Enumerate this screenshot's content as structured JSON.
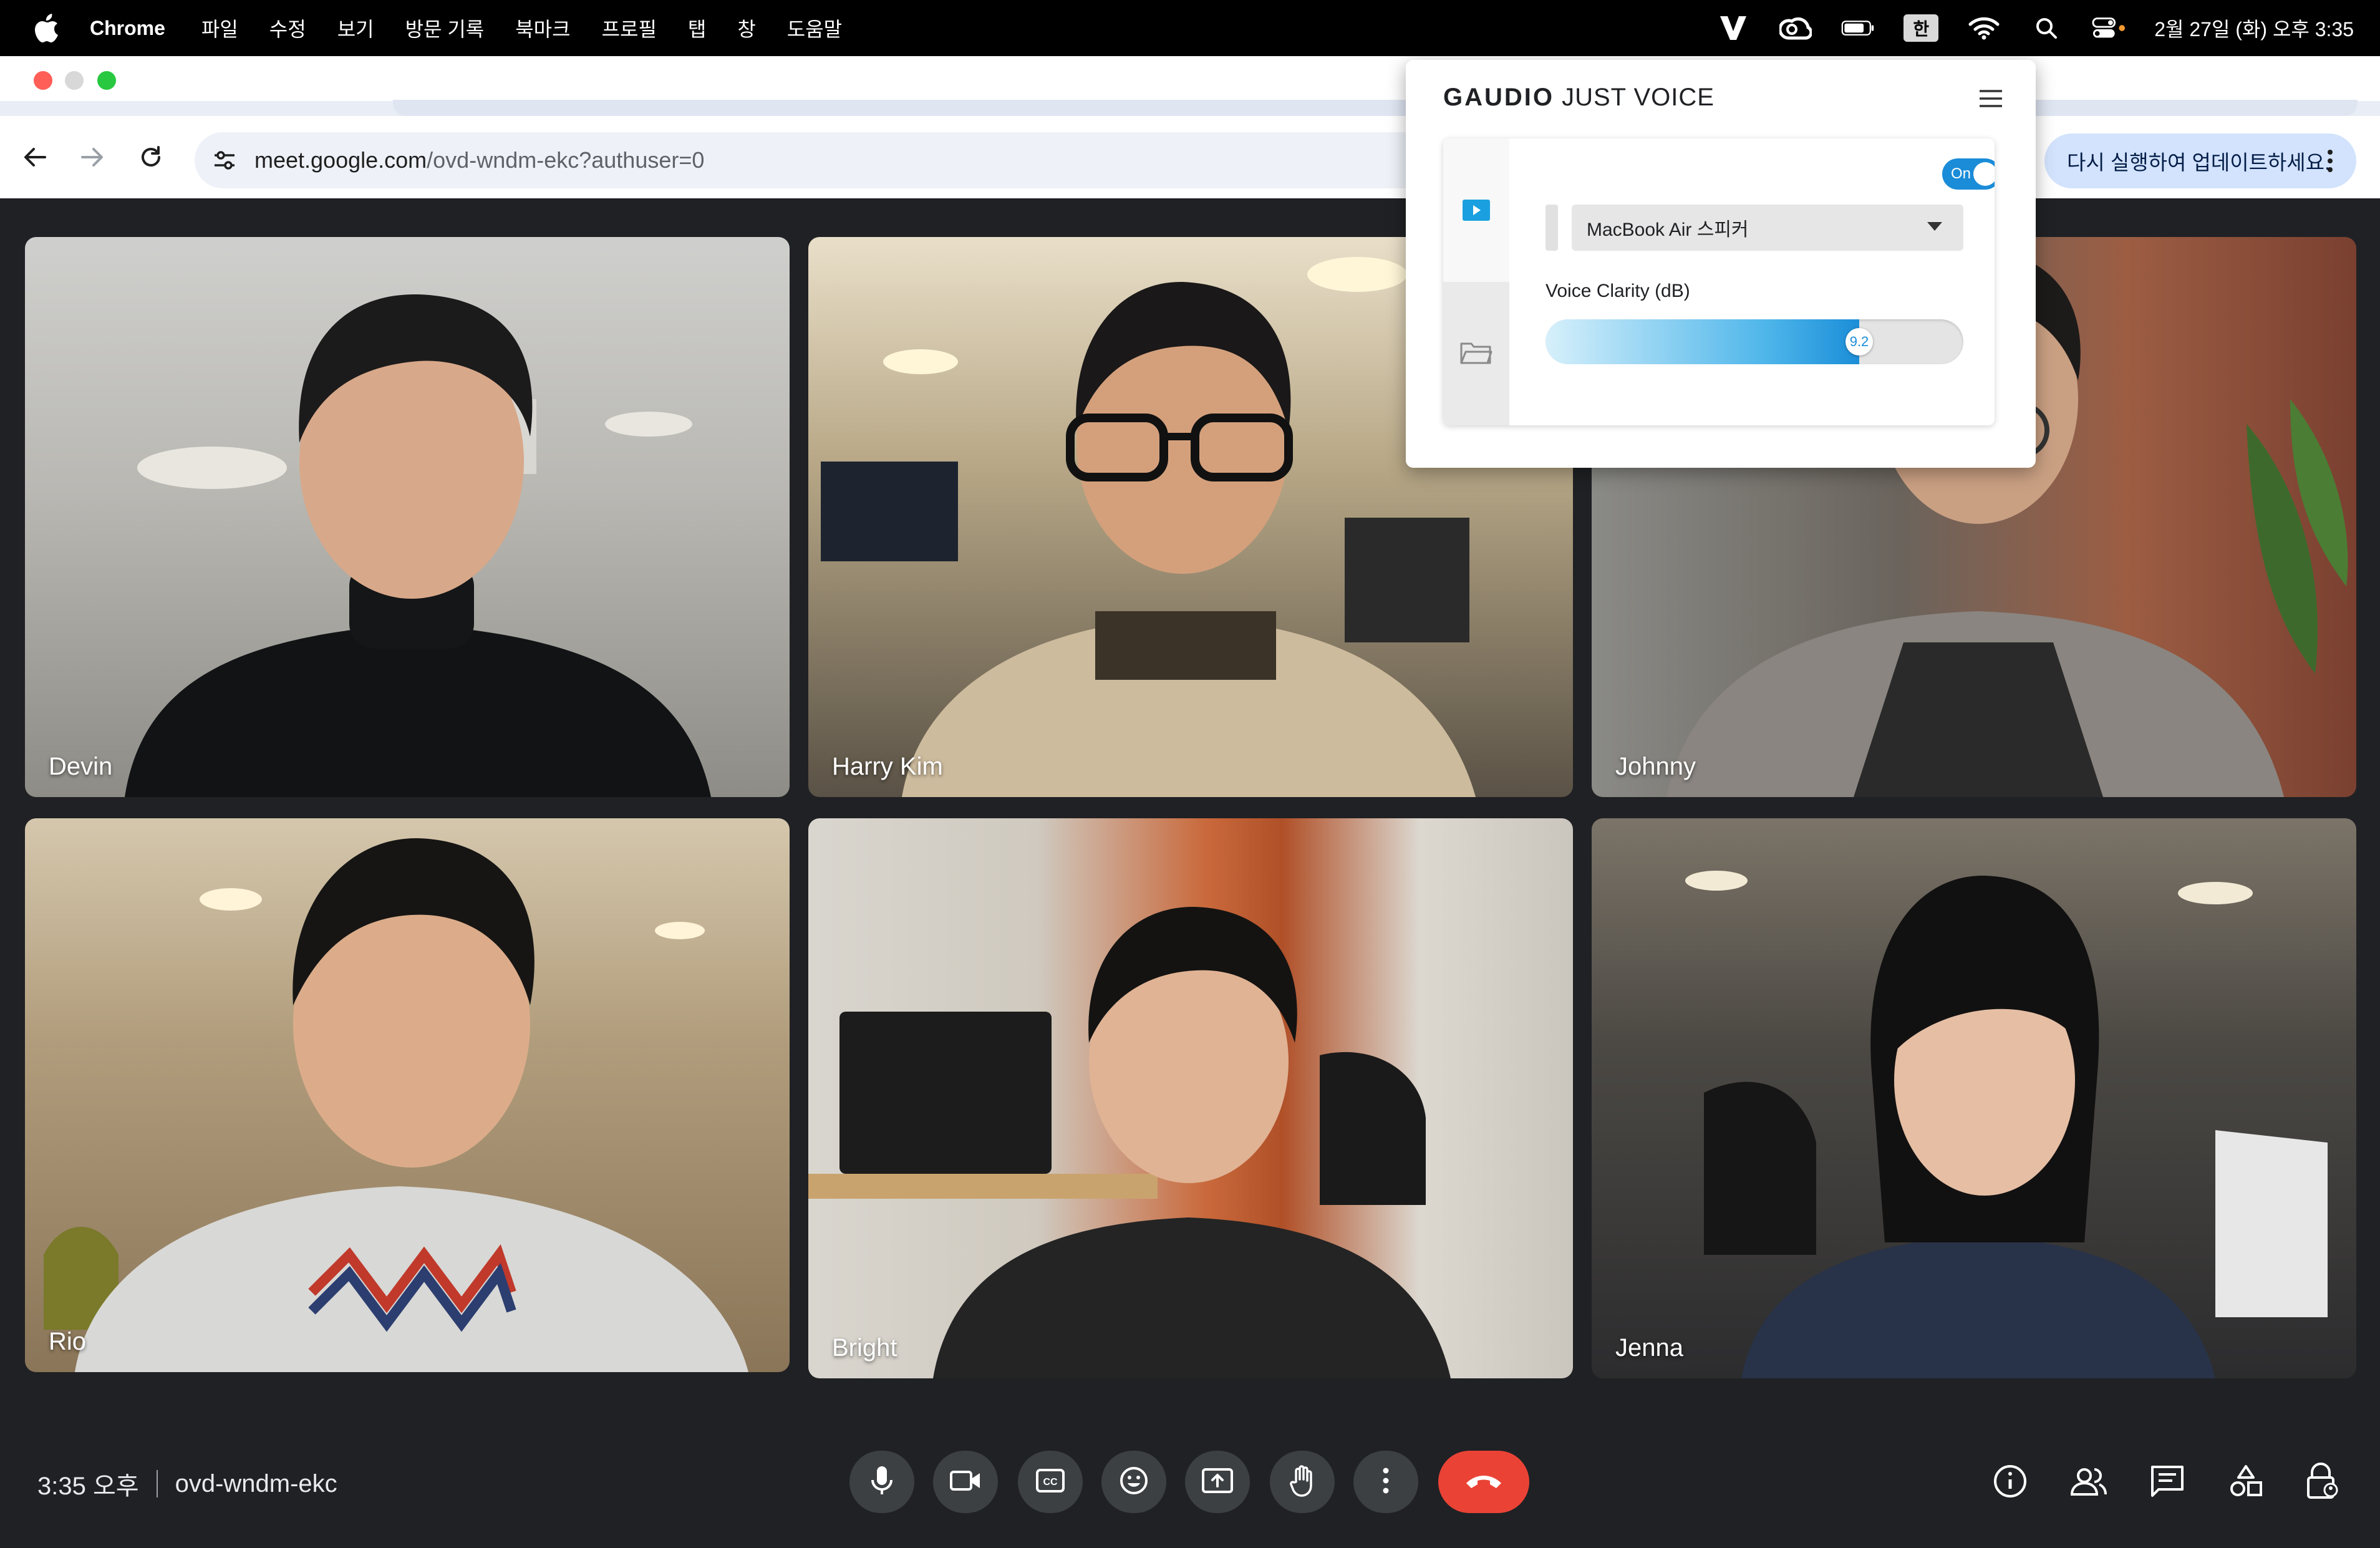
{
  "menubar": {
    "app_name": "Chrome",
    "menus": [
      "파일",
      "수정",
      "보기",
      "방문 기록",
      "북마크",
      "프로필",
      "탭",
      "창",
      "도움말"
    ],
    "ime": "한",
    "clock": "2월 27일 (화) 오후 3:35"
  },
  "browser": {
    "url_host": "meet.google.com",
    "url_path": "/ovd-wndm-ekc?authuser=0",
    "update_text": "다시 실행하여 업데이트하세요."
  },
  "participants": [
    {
      "name": "Devin"
    },
    {
      "name": "Harry Kim"
    },
    {
      "name": "Johnny"
    },
    {
      "name": "Rio"
    },
    {
      "name": "Bright"
    },
    {
      "name": "Jenna"
    }
  ],
  "meeting": {
    "time": "3:35 오후",
    "code": "ovd-wndm-ekc"
  },
  "popup": {
    "brand_bold": "GAUDIO",
    "brand_rest": " JUST VOICE",
    "toggle_label": "On",
    "device": "MacBook Air 스피커",
    "clarity_label": "Voice Clarity (dB)",
    "clarity_value": "9.2",
    "clarity_fraction": 0.75
  },
  "colors": {
    "meet_bg": "#202124",
    "control_bg": "#3c4043",
    "end_call": "#ea4335",
    "accent": "#1a8cd8"
  }
}
